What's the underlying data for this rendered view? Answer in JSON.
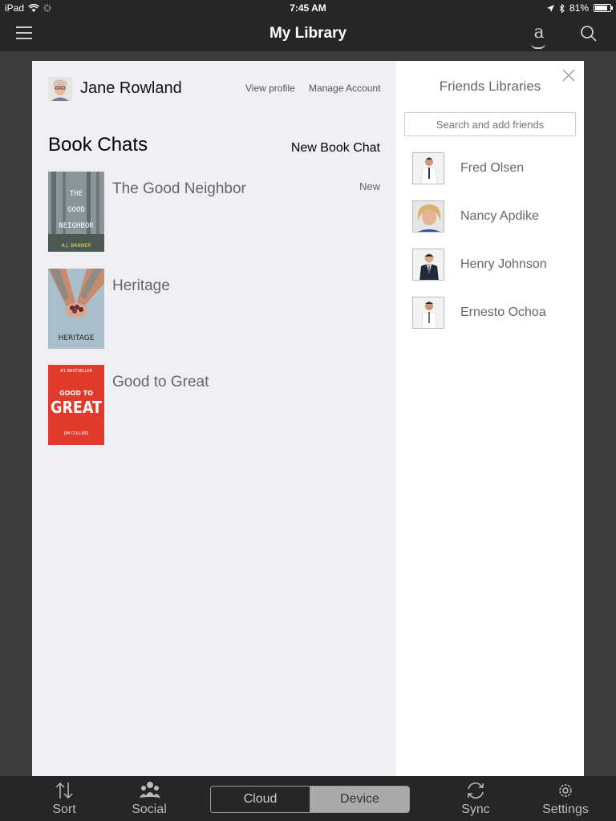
{
  "status": {
    "device": "iPad",
    "time": "7:45 AM",
    "battery": "81%",
    "battery_level": 0.81
  },
  "navbar": {
    "title": "My Library",
    "menu_icon": "hamburger-icon",
    "store_icon": "amazon-icon",
    "search_icon": "search-icon"
  },
  "profile": {
    "name": "Jane Rowland",
    "view_profile": "View profile",
    "manage_account": "Manage Account"
  },
  "book_chats": {
    "title": "Book Chats",
    "new_chat": "New Book Chat",
    "items": [
      {
        "title": "The Good Neighbor",
        "badge": "New"
      },
      {
        "title": "Heritage",
        "badge": ""
      },
      {
        "title": "Good to Great",
        "badge": ""
      }
    ]
  },
  "covers": {
    "good_neighbor": {
      "title_top": "THE",
      "title_mid": "GOOD",
      "title_bot": "NEIGHBOR",
      "author": "A.J. BANNER"
    },
    "heritage": {
      "title": "HERITAGE"
    },
    "good_to_great": {
      "banner": "#1 BESTSELLER",
      "line1": "GOOD TO",
      "line2": "GREAT",
      "author": "JIM COLLINS"
    }
  },
  "friends": {
    "title": "Friends Libraries",
    "search_placeholder": "Search and add friends",
    "items": [
      {
        "name": "Fred Olsen"
      },
      {
        "name": "Nancy Apdike"
      },
      {
        "name": "Henry Johnson"
      },
      {
        "name": "Ernesto Ochoa"
      }
    ]
  },
  "tabbar": {
    "sort": "Sort",
    "social": "Social",
    "cloud": "Cloud",
    "device": "Device",
    "sync": "Sync",
    "settings": "Settings"
  },
  "colors": {
    "bar": "#262626",
    "panel": "#efeff4",
    "cover_red": "#e03a2a"
  }
}
